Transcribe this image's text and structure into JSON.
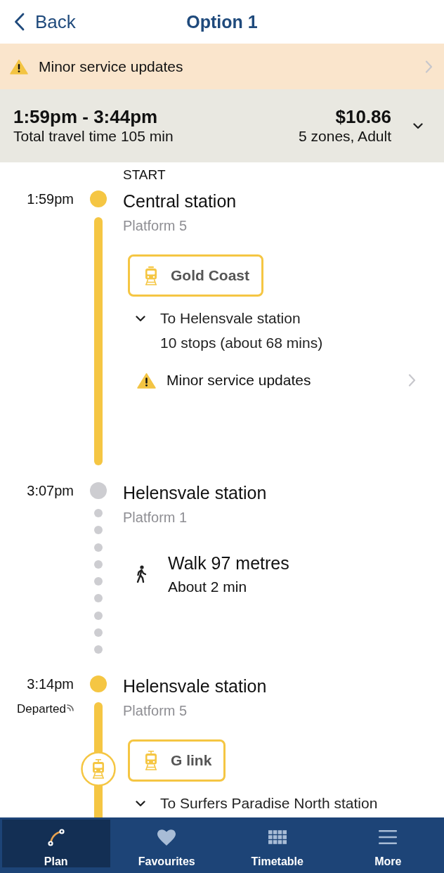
{
  "header": {
    "back": "Back",
    "title": "Option 1"
  },
  "alert_banner": {
    "text": "Minor service updates"
  },
  "summary": {
    "times": "1:59pm - 3:44pm",
    "duration": "Total travel time 105 min",
    "fare": "$10.86",
    "fare_detail": "5 zones, Adult"
  },
  "timeline": {
    "start_label": "START",
    "stops": [
      {
        "time": "1:59pm",
        "name": "Central station",
        "platform": "Platform 5",
        "color": "#f5c643",
        "leg": {
          "kind": "train",
          "service": "Gold Coast",
          "direction": "To Helensvale station",
          "stops": "10 stops (about 68 mins)",
          "alert": "Minor service updates"
        }
      },
      {
        "time": "3:07pm",
        "name": "Helensvale station",
        "platform": "Platform 1",
        "color": "#cdcdd1",
        "leg": {
          "kind": "walk",
          "title": "Walk 97 metres",
          "duration": "About 2 min"
        }
      },
      {
        "time": "3:14pm",
        "status": "Departed",
        "name": "Helensvale station",
        "platform": "Platform 5",
        "color": "#f5c643",
        "leg": {
          "kind": "tram",
          "service": "G link",
          "direction": "To Surfers Paradise North station",
          "live_marker": true
        }
      }
    ]
  },
  "tabs": [
    {
      "label": "Plan",
      "selected": true
    },
    {
      "label": "Favourites",
      "selected": false
    },
    {
      "label": "Timetable",
      "selected": false
    },
    {
      "label": "More",
      "selected": false
    }
  ]
}
